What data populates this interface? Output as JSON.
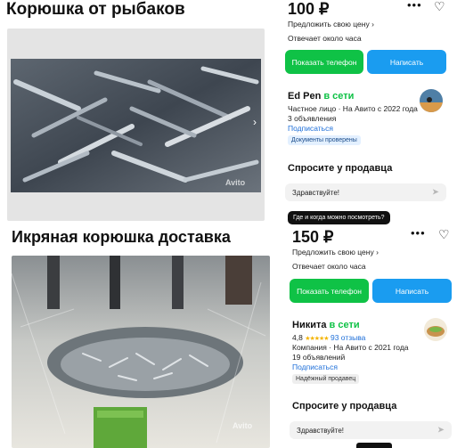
{
  "listing1": {
    "title": "Корюшка от рыбаков",
    "price": "100 ₽",
    "suggest_price": "Предложить свою цену ›",
    "response_time": "Отвечает около часа",
    "show_phone": "Показать телефон",
    "write": "Написать",
    "watermark": "Avito",
    "seller": {
      "name": "Ed Pen",
      "status": "в сети",
      "details": "Частное лицо · На Авито с 2022 года",
      "ads_count": "3 объявления",
      "subscribe": "Подписаться",
      "badge": "Документы проверены"
    },
    "ask_title": "Спросите у продавца",
    "ask_input": "Здравствуйте!",
    "ask_chip": "Где и когда можно посмотреть?"
  },
  "listing2": {
    "title": "Икряная корюшка доставка",
    "price": "150 ₽",
    "suggest_price": "Предложить свою цену ›",
    "response_time": "Отвечает около часа",
    "show_phone": "Показать телефон",
    "write": "Написать",
    "watermark": "Avito",
    "seller": {
      "name": "Никита",
      "status": "в сети",
      "rating": "4,8",
      "stars": "★★★★★",
      "reviews": "93 отзыва",
      "details": "Компания · На Авито с 2021 года",
      "ads_count": "19 объявлений",
      "subscribe": "Подписаться",
      "badge": "Надёжный продавец"
    },
    "ask_title": "Спросите у продавца",
    "ask_input": "Здравствуйте!"
  },
  "colors": {
    "green": "#0fc246",
    "blue": "#1a9cf0",
    "link": "#1e6fd9"
  }
}
